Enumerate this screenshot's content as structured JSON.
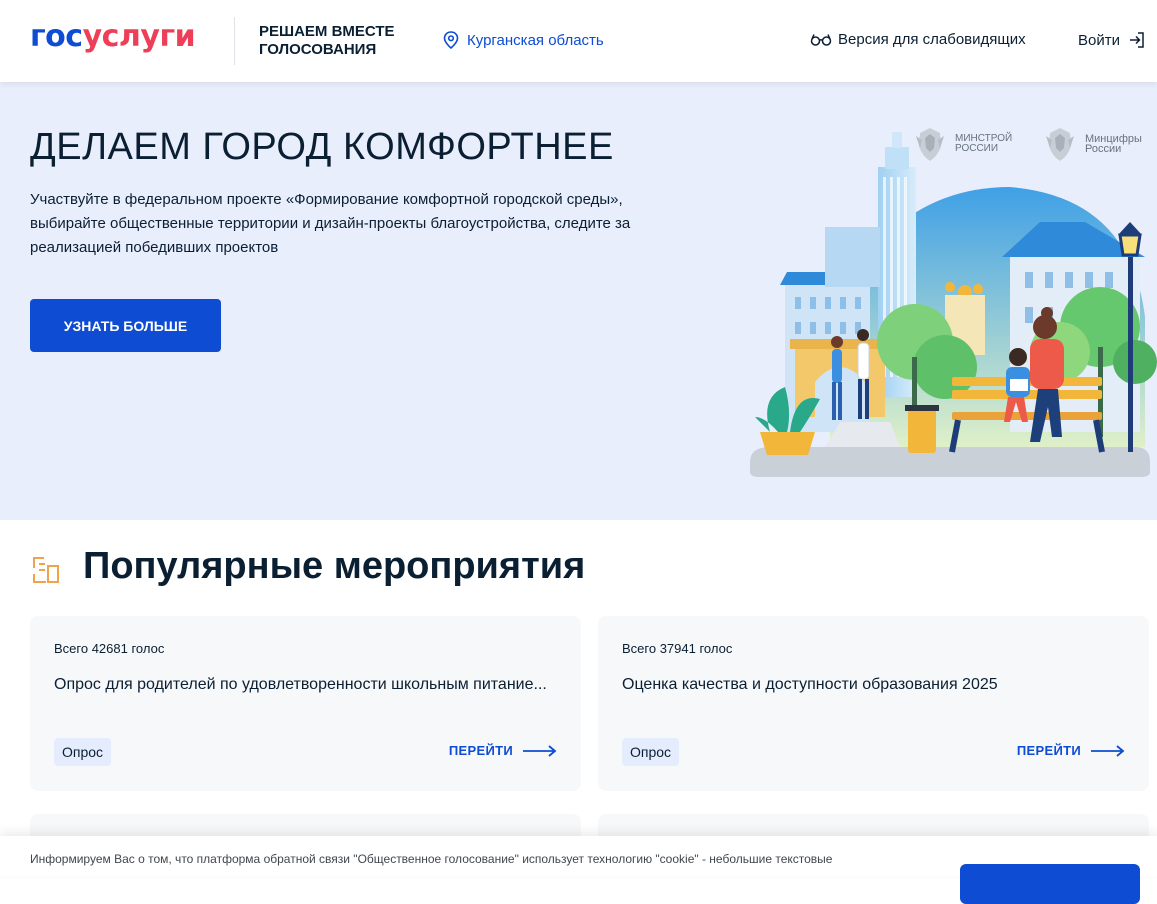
{
  "header": {
    "logo_part1": "гос",
    "logo_part2": "услуги",
    "tagline": "РЕШАЕМ ВМЕСТЕ ГОЛОСОВАНИЯ",
    "region": "Курганская область",
    "vision_label": "Версия для слабовидящих",
    "login_label": "Войти"
  },
  "hero": {
    "title": "ДЕЛАЕМ ГОРОД КОМФОРТНЕЕ",
    "text": "Участвуйте в федеральном проекте «Формирование комфортной городской среды», выбирайте общественные территории и дизайн-проекты благоустройства, следите за реализацией победивших проектов",
    "button_label": "УЗНАТЬ БОЛЬШЕ",
    "ministry1": "МИНСТРОЙ РОССИИ",
    "ministry2": "Минцифры России"
  },
  "popular": {
    "title": "Популярные мероприятия",
    "cards": [
      {
        "votes": "Всего 42681 голос",
        "title": "Опрос для родителей по удовлетворенности школьным питание...",
        "badge": "Опрос",
        "action": "ПЕРЕЙТИ"
      },
      {
        "votes": "Всего 37941 голос",
        "title": "Оценка качества и доступности образования 2025",
        "badge": "Опрос",
        "action": "ПЕРЕЙТИ"
      }
    ]
  },
  "cookie": {
    "text": "Информируем Вас о том, что платформа обратной связи \"Общественное голосование\" использует технологию \"cookie\" - небольшие текстовые"
  },
  "colors": {
    "brand_blue": "#0d4cd3",
    "brand_red": "#ee3f58",
    "hero_bg": "#e9eefc",
    "card_bg": "#f7f8fa",
    "accent_orange": "#f0a34b"
  }
}
